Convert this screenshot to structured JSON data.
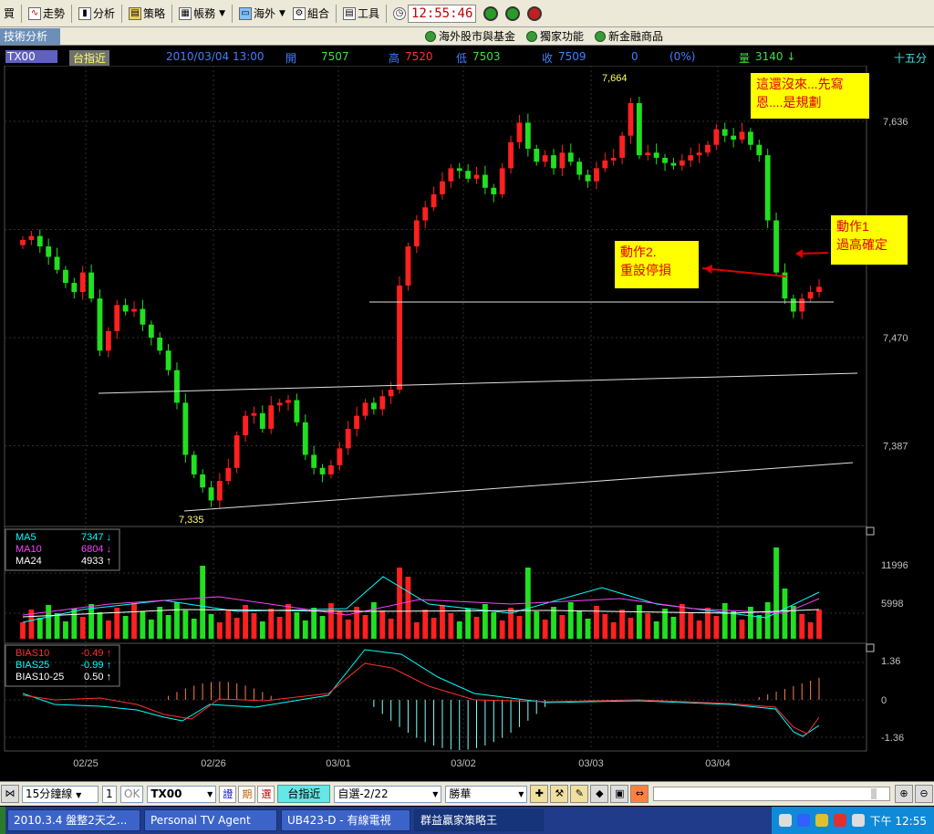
{
  "toolbar": {
    "items": [
      {
        "label": "買",
        "icon": "buy-icon"
      },
      {
        "label": "走勢",
        "icon": "trend-icon"
      },
      {
        "label": "分析",
        "icon": "analysis-icon"
      },
      {
        "label": "策略",
        "icon": "strategy-icon"
      },
      {
        "label": "帳務",
        "icon": "account-icon"
      },
      {
        "label": "海外",
        "icon": "overseas-icon"
      },
      {
        "label": "組合",
        "icon": "combo-icon"
      },
      {
        "label": "工具",
        "icon": "tools-icon"
      }
    ],
    "clock": "12:55:46"
  },
  "row2": {
    "tab": "技術分析",
    "links": [
      "海外股市與基金",
      "獨家功能",
      "新金融商品"
    ]
  },
  "header": {
    "symbol": "TX00",
    "symbol_name": "台指近",
    "datetime": "2010/03/04 13:00",
    "open_label": "開",
    "open": "7507",
    "high_label": "高",
    "high": "7520",
    "low_label": "低",
    "low": "7503",
    "close_label": "收",
    "close": "7509",
    "change": "0",
    "change_pct": "(0%)",
    "vol_label": "量",
    "vol": "3140 ↓",
    "period": "十五分"
  },
  "chart_data": {
    "type": "candlestick",
    "price_axis": {
      "ticks": [
        "7,636",
        "7,470",
        "7,387"
      ],
      "min": 7320,
      "max": 7680
    },
    "annotations_price": {
      "high": "7,664",
      "low": "7,335"
    },
    "date_ticks": [
      "02/25",
      "02/26",
      "03/01",
      "03/02",
      "03/03",
      "03/04"
    ],
    "notes": [
      {
        "text1": "這還沒來...先寫",
        "text2": "恩....是規劃"
      },
      {
        "text1": "動作1",
        "text2": "過高確定"
      },
      {
        "text1": "動作2.",
        "text2": "重設停損"
      }
    ],
    "volume_legend": [
      {
        "name": "MA5",
        "value": "7347",
        "arrow": "↓",
        "color": "#00ffff"
      },
      {
        "name": "MA10",
        "value": "6804",
        "arrow": "↓",
        "color": "#ff40ff"
      },
      {
        "name": "MA24",
        "value": "4933",
        "arrow": "↑",
        "color": "#ffffff"
      }
    ],
    "volume_axis": {
      "ticks": [
        "11996",
        "5998"
      ]
    },
    "bias_legend": [
      {
        "name": "BIAS10",
        "value": "-0.49",
        "arrow": "↑",
        "color": "#ff3030"
      },
      {
        "name": "BIAS25",
        "value": "-0.99",
        "arrow": "↑",
        "color": "#00ffff"
      },
      {
        "name": "BIAS10-25",
        "value": "0.50",
        "arrow": "↑",
        "color": "#ffffff"
      }
    ],
    "bias_axis": {
      "ticks": [
        "1.36",
        "0",
        "-1.36"
      ]
    }
  },
  "controls": {
    "interval": "15分鐘線",
    "count": "1",
    "ok": "OK",
    "symbol": "TX00",
    "btn_zheng": "證",
    "btn_qi": "期",
    "btn_xuan": "選",
    "symbol_name": "台指近",
    "watchlist": "自選-2/22",
    "stock": "勝華"
  },
  "taskbar": {
    "tasks": [
      "2010.3.4 盤整2天之...",
      "Personal TV Agent",
      "UB423-D - 有線電視",
      "群益贏家策略王"
    ],
    "time": "下午 12:55"
  }
}
